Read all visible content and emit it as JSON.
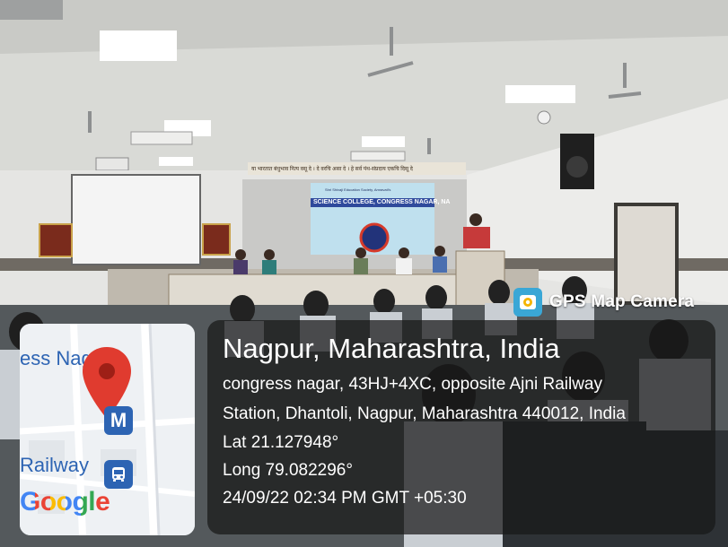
{
  "photo": {
    "banner": {
      "top_text": "Shri Shivaji Education Society, Amravati's",
      "college_name": "SCIENCE COLLEGE, CONGRESS NAGAR, NA",
      "top_strip_text": "या भारतात बंधुभाव नित्य वसू दे । दे वरचि असा दे । हे सर्व पंथ-संप्रदाय एकचि दिसू दे"
    }
  },
  "watermark": {
    "app_name": "GPS Map Camera",
    "icon": "map-pin-camera-icon",
    "accent_color": "#3aa7d6"
  },
  "map": {
    "labels": {
      "area": "ess Nagar",
      "railway": "Railway",
      "provider": "Google"
    },
    "pin_color": "#e03b2f",
    "metro_icon": "metro-icon",
    "bus_icon": "bus-icon"
  },
  "location": {
    "title": "Nagpur, Maharashtra, India",
    "address_line1": "congress nagar, 43HJ+4XC, opposite Ajni Railway",
    "address_line2": "Station, Dhantoli, Nagpur, Maharashtra 440012, India",
    "lat": "Lat 21.127948°",
    "long": "Long 79.082296°",
    "timestamp": "24/09/22 02:34 PM GMT +05:30"
  }
}
